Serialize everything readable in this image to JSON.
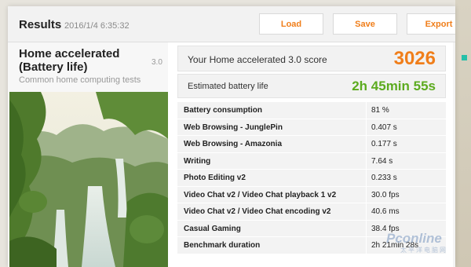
{
  "header": {
    "title": "Results",
    "timestamp": "2016/1/4 6:35:32",
    "buttons": {
      "load": "Load",
      "save": "Save",
      "export": "Export"
    }
  },
  "test": {
    "name": "Home accelerated (Battery life)",
    "version": "3.0",
    "description": "Common home computing tests"
  },
  "score": {
    "label": "Your Home accelerated 3.0 score",
    "value": "3026"
  },
  "battery": {
    "label": "Estimated battery life",
    "value": "2h 45min 55s"
  },
  "results": [
    {
      "name": "Battery consumption",
      "value": "81 %"
    },
    {
      "name": "Web Browsing - JunglePin",
      "value": "0.407 s"
    },
    {
      "name": "Web Browsing - Amazonia",
      "value": "0.177 s"
    },
    {
      "name": "Writing",
      "value": "7.64 s"
    },
    {
      "name": "Photo Editing v2",
      "value": "0.233 s"
    },
    {
      "name": "Video Chat v2 / Video Chat playback 1 v2",
      "value": "30.0 fps"
    },
    {
      "name": "Video Chat v2 / Video Chat encoding v2",
      "value": "40.6 ms"
    },
    {
      "name": "Casual Gaming",
      "value": "38.4 fps"
    },
    {
      "name": "Benchmark duration",
      "value": "2h 21min 28s"
    }
  ],
  "watermark": {
    "brand": "Pconline",
    "sub": "太平洋电脑网"
  },
  "colors": {
    "accent_orange": "#f07e1a",
    "accent_green": "#5cab1f",
    "teal": "#25c0a8"
  }
}
